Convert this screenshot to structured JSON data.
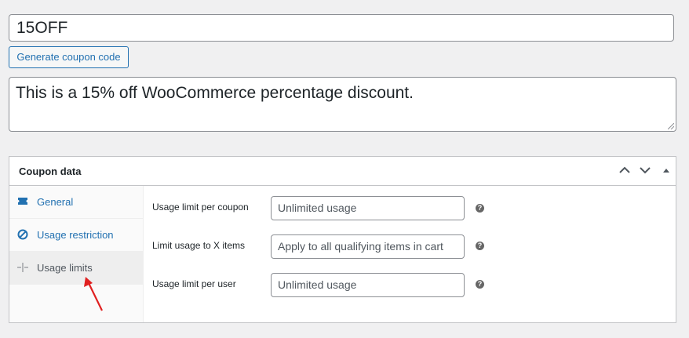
{
  "coupon": {
    "code": "15OFF",
    "generate_label": "Generate coupon code",
    "description": "This is a 15% off WooCommerce percentage discount."
  },
  "panel": {
    "title": "Coupon data",
    "controls": [
      "chevron-up-icon",
      "chevron-down-icon",
      "toggle-triangle-icon"
    ],
    "tabs": [
      {
        "label": "General",
        "icon": "ticket-icon"
      },
      {
        "label": "Usage restriction",
        "icon": "ban-icon"
      },
      {
        "label": "Usage limits",
        "icon": "limits-icon",
        "active": true
      }
    ],
    "fields": [
      {
        "label": "Usage limit per coupon",
        "placeholder": "Unlimited usage"
      },
      {
        "label": "Limit usage to X items",
        "placeholder": "Apply to all qualifying items in cart"
      },
      {
        "label": "Usage limit per user",
        "placeholder": "Unlimited usage"
      }
    ],
    "help_glyph": "?"
  },
  "colors": {
    "accent": "#2271b1",
    "annotation_arrow": "#e02020"
  }
}
